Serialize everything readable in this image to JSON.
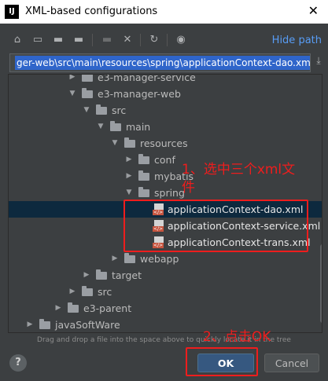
{
  "window": {
    "title": "XML-based configurations",
    "app_icon": "intellij-icon",
    "close_glyph": "✕"
  },
  "toolbar": {
    "icons": [
      "home-icon",
      "desktop-icon",
      "folder-icon",
      "new-folder-icon",
      "move-icon",
      "delete-icon",
      "refresh-icon",
      "show-hidden-icon"
    ],
    "hide_path_label": "Hide path"
  },
  "path": {
    "value": "ger-web\\src\\main\\resources\\spring\\applicationContext-dao.xml"
  },
  "tree": {
    "rows": [
      {
        "label": "e3-manager-service",
        "expanded": false
      },
      {
        "label": "e3-manager-web",
        "expanded": true
      },
      {
        "label": "src",
        "expanded": true
      },
      {
        "label": "main",
        "expanded": true
      },
      {
        "label": "resources",
        "expanded": true
      },
      {
        "label": "conf",
        "expanded": false
      },
      {
        "label": "mybatis",
        "expanded": false
      },
      {
        "label": "spring",
        "expanded": true
      },
      {
        "label": "applicationContext-dao.xml",
        "selected": true
      },
      {
        "label": "applicationContext-service.xml"
      },
      {
        "label": "applicationContext-trans.xml"
      },
      {
        "label": "webapp",
        "expanded": false
      },
      {
        "label": "target",
        "expanded": false
      },
      {
        "label": "src",
        "expanded": false
      },
      {
        "label": "e3-parent",
        "expanded": false
      },
      {
        "label": "javaSoftWare",
        "expanded": false
      }
    ]
  },
  "hint": "Drag and drop a file into the space above to quickly locate it in the tree",
  "buttons": {
    "help": "?",
    "ok": "OK",
    "cancel": "Cancel"
  },
  "annotations": {
    "step1_line1": "1、选中三个xml文",
    "step1_line2": "件",
    "step2": "2、点击OK",
    "color": "#ee1d1d"
  },
  "colors": {
    "background": "#3c3f41",
    "selection": "#2f65ca",
    "link": "#589df6",
    "ok_button": "#365880"
  }
}
